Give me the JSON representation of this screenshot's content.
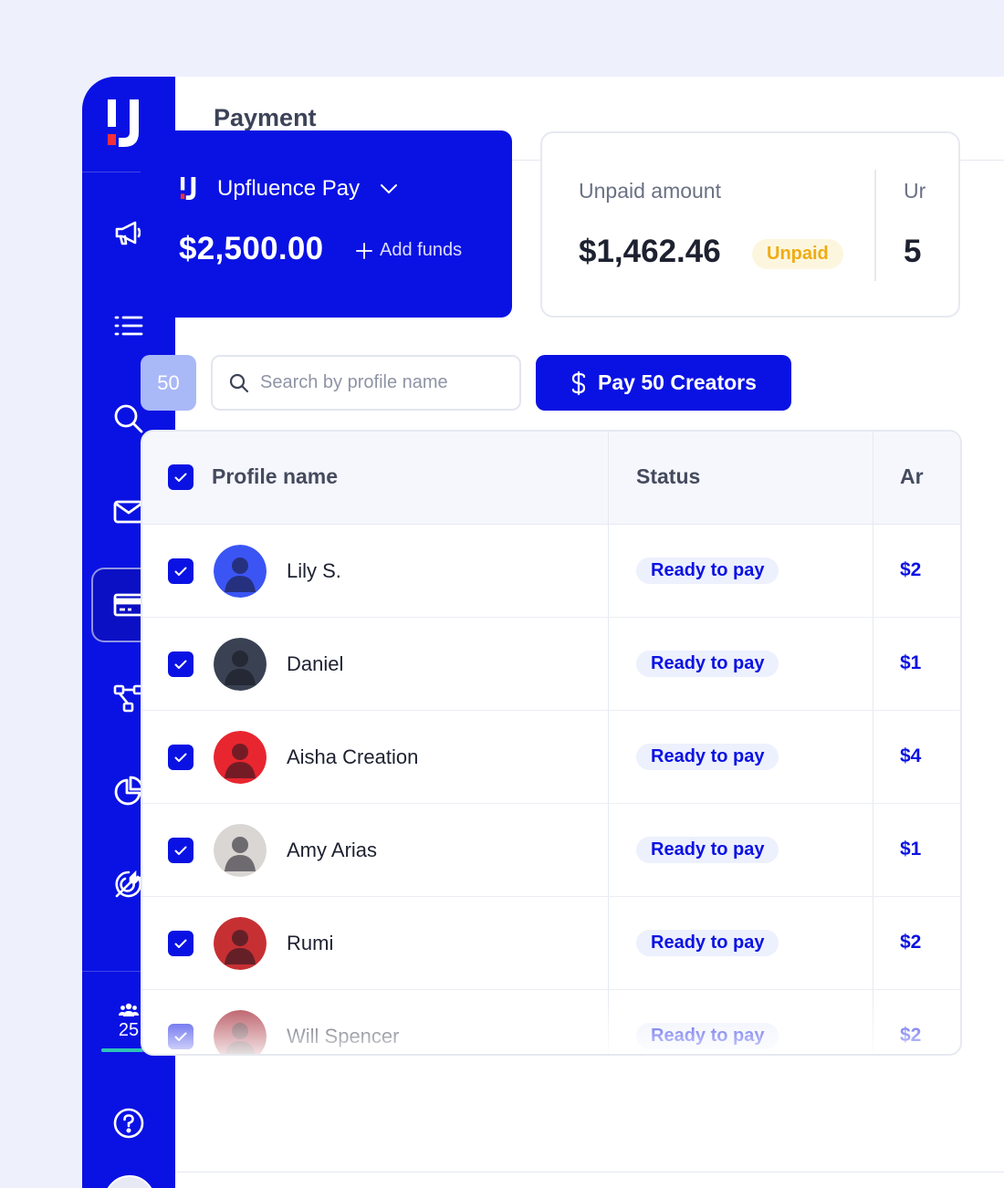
{
  "header": {
    "title": "Payment"
  },
  "pay_card": {
    "brand": "Upfluence Pay",
    "balance": "$2,500.00",
    "add_funds": "Add funds"
  },
  "unpaid_card": {
    "label": "Unpaid amount",
    "amount": "$1,462.46",
    "badge": "Unpaid",
    "next_label": "Ur",
    "next_value": "5"
  },
  "toolbar": {
    "count": "50",
    "search_placeholder": "Search by profile name",
    "pay_button": "Pay 50 Creators"
  },
  "table": {
    "columns": [
      "Profile name",
      "Status",
      "Ar"
    ],
    "rows": [
      {
        "name": "Lily S.",
        "status": "Ready to pay",
        "amount": "$2",
        "avatar_color": "#3b55f5"
      },
      {
        "name": "Daniel",
        "status": "Ready to pay",
        "amount": "$1",
        "avatar_color": "#3a4152"
      },
      {
        "name": "Aisha Creation",
        "status": "Ready to pay",
        "amount": "$4",
        "avatar_color": "#e8262f"
      },
      {
        "name": "Amy Arias",
        "status": "Ready to pay",
        "amount": "$1",
        "avatar_color": "#d9d6d3"
      },
      {
        "name": "Rumi",
        "status": "Ready to pay",
        "amount": "$2",
        "avatar_color": "#c73033"
      },
      {
        "name": "Will Spencer",
        "status": "Ready to pay",
        "amount": "$2",
        "avatar_color": "#a8313d"
      }
    ]
  },
  "sidebar": {
    "team_count": "25",
    "team_progress": 0.75,
    "items": [
      "megaphone-icon",
      "list-icon",
      "search-icon",
      "mail-icon",
      "credit-card-icon",
      "workflow-icon",
      "pie-chart-icon",
      "target-icon"
    ]
  },
  "colors": {
    "brand_blue": "#0a12e3",
    "badge_yellow": "#f0ac12",
    "logo_red": "#f0303a"
  }
}
